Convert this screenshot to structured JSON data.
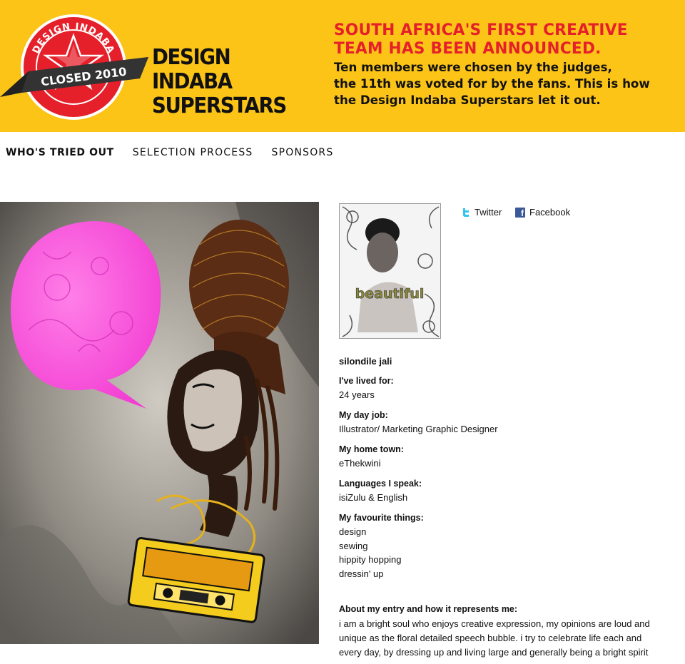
{
  "header": {
    "badge_top_text": "DESIGN INDABA",
    "badge_bottom_text": "SUPERSTARS",
    "badge_ribbon": "CLOSED 2010",
    "brand_line1": "DESIGN INDABA",
    "brand_line2": "SUPERSTARS",
    "headline": "SOUTH AFRICA'S FIRST CREATIVE\nTEAM HAS BEEN ANNOUNCED.",
    "subhead": "Ten members were chosen by the judges,\nthe 11th was voted for by the fans. This is how\nthe Design Indaba Superstars let it out.",
    "bg_color": "#fcc417",
    "accent_red": "#e5202a"
  },
  "nav": {
    "items": [
      {
        "label": "WHO'S TRIED OUT",
        "active": true
      },
      {
        "label": "SELECTION PROCESS",
        "active": false
      },
      {
        "label": "SPONSORS",
        "active": false
      }
    ]
  },
  "social": {
    "twitter": {
      "label": "Twitter",
      "icon": "twitter-icon"
    },
    "facebook": {
      "label": "Facebook",
      "icon": "facebook-icon"
    }
  },
  "thumbnail": {
    "caption": "beautiful"
  },
  "profile": {
    "name": "silondile jali",
    "lived_label": "I've lived for:",
    "lived_value": "24 years",
    "job_label": "My day job:",
    "job_value": "Illustrator/ Marketing Graphic Designer",
    "hometown_label": "My home town:",
    "hometown_value": "eThekwini",
    "languages_label": "Languages I speak:",
    "languages_value": "isiZulu & English",
    "favourites_label": "My favourite things:",
    "favourites": [
      "design",
      "sewing",
      "hippity hopping",
      "dressin' up"
    ],
    "about_label": "About my entry and how it represents me:",
    "about_value": "i am a bright soul who enjoys creative expression, my opinions are loud and unique as the floral detailed speech bubble. i try to celebrate life each and every day, by dressing up and living large and generally being a bright spirit"
  }
}
